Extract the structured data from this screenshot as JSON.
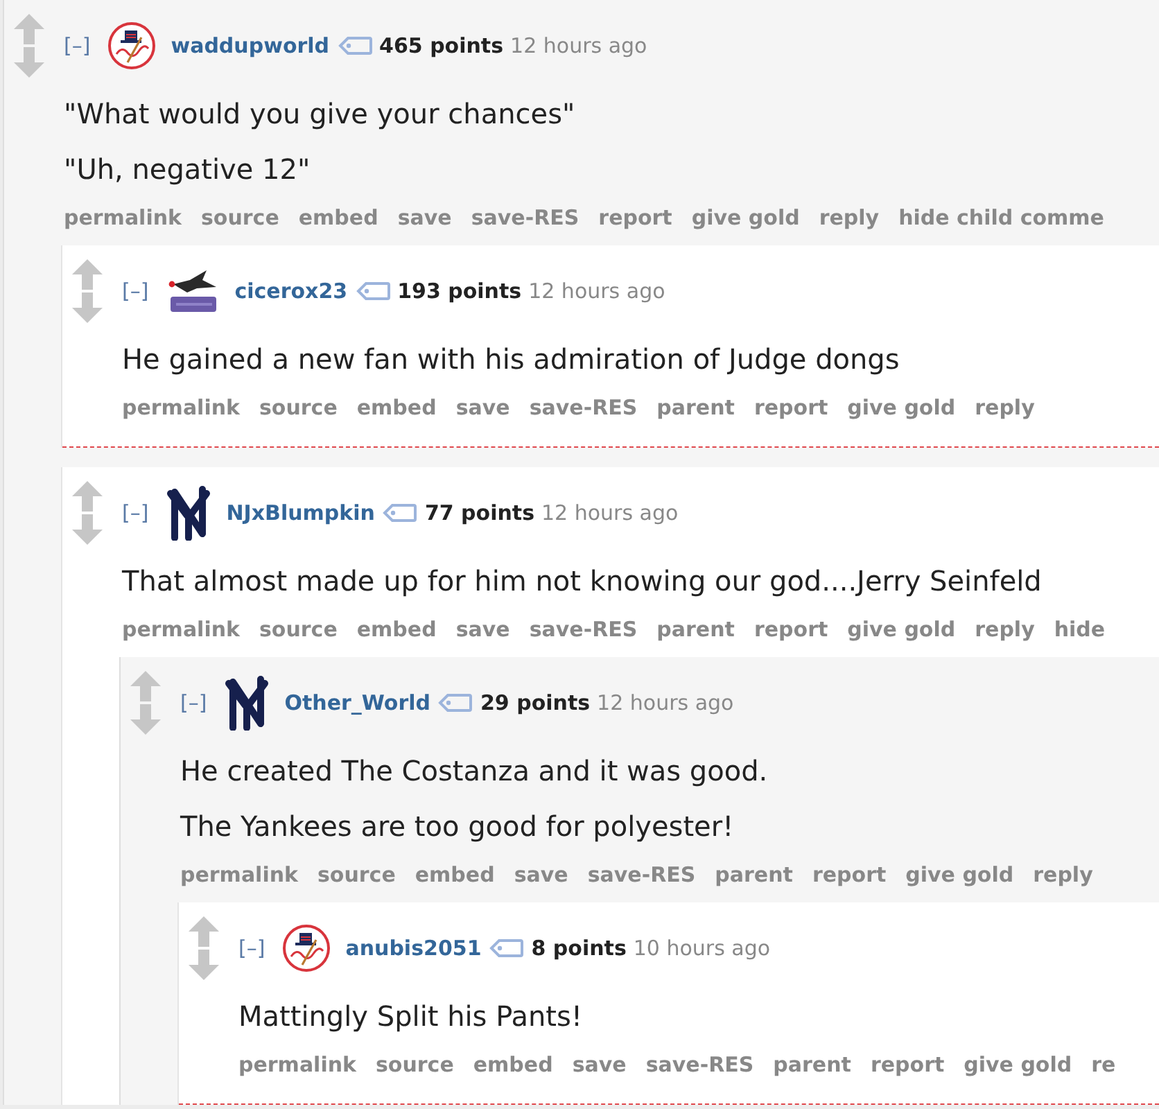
{
  "comments": [
    {
      "toggle": "[–]",
      "flair": {
        "kind": "ring"
      },
      "author": "waddupworld",
      "score": "465 points",
      "time": "12 hours ago",
      "body": [
        "\"What would you give your chances\"",
        "\"Uh, negative 12\""
      ],
      "actions": [
        "permalink",
        "source",
        "embed",
        "save",
        "save-RES",
        "report",
        "give gold",
        "reply",
        "hide child comme"
      ],
      "children": [
        {
          "toggle": "[–]",
          "flair": {
            "kind": "batter"
          },
          "author": "cicerox23",
          "score": "193 points",
          "time": "12 hours ago",
          "body": [
            "He gained a new fan with his admiration of Judge dongs"
          ],
          "actions": [
            "permalink",
            "source",
            "embed",
            "save",
            "save-RES",
            "parent",
            "report",
            "give gold",
            "reply"
          ]
        },
        {
          "toggle": "[–]",
          "flair": {
            "kind": "monogram"
          },
          "author": "NJxBlumpkin",
          "score": "77 points",
          "time": "12 hours ago",
          "body": [
            "That almost made up for him not knowing our god....Jerry Seinfeld"
          ],
          "actions": [
            "permalink",
            "source",
            "embed",
            "save",
            "save-RES",
            "parent",
            "report",
            "give gold",
            "reply",
            "hide"
          ],
          "children": [
            {
              "toggle": "[–]",
              "flair": {
                "kind": "monogram"
              },
              "author": "Other_World",
              "score": "29 points",
              "time": "12 hours ago",
              "body": [
                "He created The Costanza and it was good.",
                "The Yankees are too good for polyester!"
              ],
              "actions": [
                "permalink",
                "source",
                "embed",
                "save",
                "save-RES",
                "parent",
                "report",
                "give gold",
                "reply"
              ],
              "children": [
                {
                  "toggle": "[–]",
                  "flair": {
                    "kind": "ring"
                  },
                  "author": "anubis2051",
                  "score": "8 points",
                  "time": "10 hours ago",
                  "body": [
                    "Mattingly Split his Pants!"
                  ],
                  "actions": [
                    "permalink",
                    "source",
                    "embed",
                    "save",
                    "save-RES",
                    "parent",
                    "report",
                    "give gold",
                    "re"
                  ]
                }
              ]
            }
          ]
        }
      ]
    }
  ]
}
